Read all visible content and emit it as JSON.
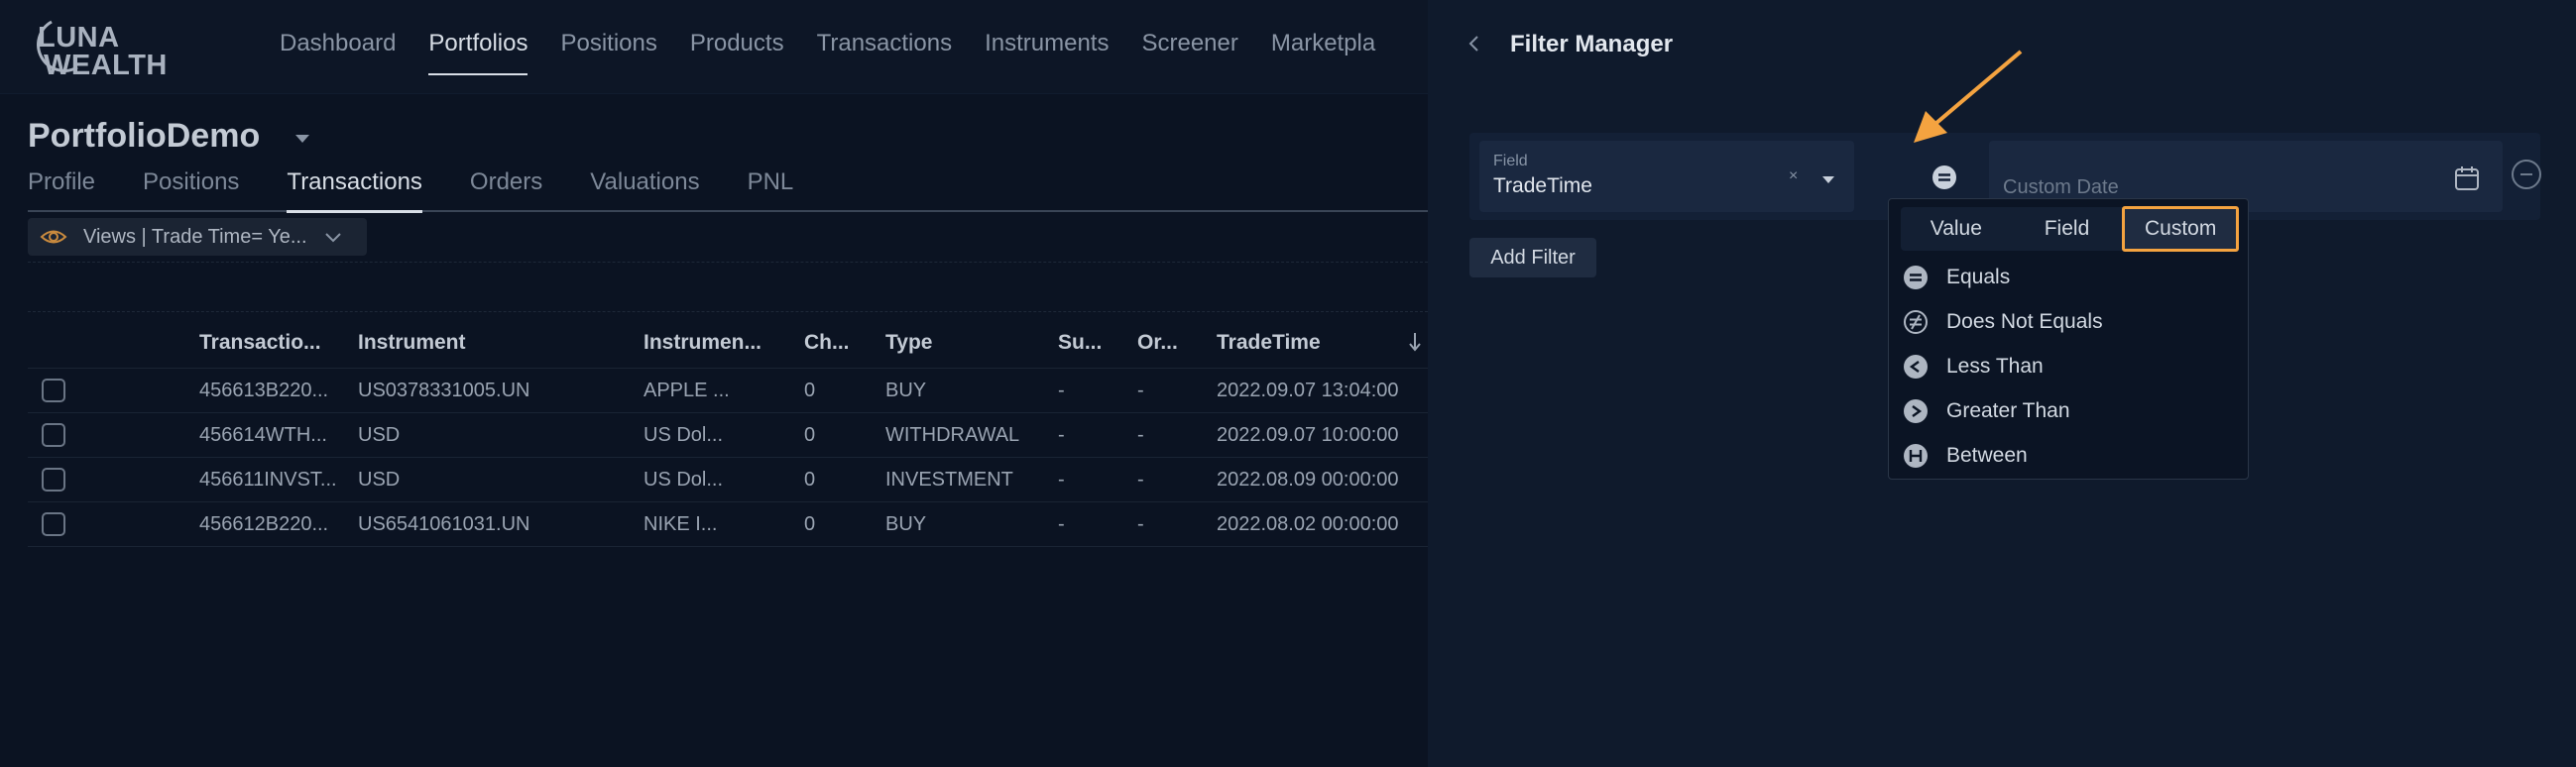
{
  "app": {
    "logo_line1": "LUNA",
    "logo_line2": "WEALTH",
    "nav": [
      "Dashboard",
      "Portfolios",
      "Positions",
      "Products",
      "Transactions",
      "Instruments",
      "Screener",
      "Marketpla"
    ],
    "portfolio_name": "PortfolioDemo",
    "subtabs": [
      "Profile",
      "Positions",
      "Transactions",
      "Orders",
      "Valuations",
      "PNL"
    ],
    "views_label": "Views | Trade Time= Ye..."
  },
  "table": {
    "headers": [
      "Transactio...",
      "Instrument",
      "Instrumen...",
      "Ch...",
      "Type",
      "Su...",
      "Or...",
      "TradeTime"
    ],
    "rows": [
      [
        "456613B220...",
        "US0378331005.UN",
        "APPLE ...",
        "0",
        "BUY",
        "-",
        "-",
        "2022.09.07 13:04:00"
      ],
      [
        "456614WTH...",
        "USD",
        "US Dol...",
        "0",
        "WITHDRAWAL",
        "-",
        "-",
        "2022.09.07 10:00:00"
      ],
      [
        "456611INVST...",
        "USD",
        "US Dol...",
        "0",
        "INVESTMENT",
        "-",
        "-",
        "2022.08.09 00:00:00"
      ],
      [
        "456612B220...",
        "US6541061031.UN",
        "NIKE I...",
        "0",
        "BUY",
        "-",
        "-",
        "2022.08.02 00:00:00"
      ]
    ]
  },
  "panel": {
    "title": "Filter Manager",
    "field_label": "Field",
    "field_value": "TradeTime",
    "field_clear": "×",
    "date_placeholder": "Custom Date",
    "add_filter": "Add Filter"
  },
  "dropdown": {
    "segments": [
      "Value",
      "Field",
      "Custom"
    ],
    "selected_segment": "Custom",
    "options": [
      "Equals",
      "Does Not Equals",
      "Less Than",
      "Greater Than",
      "Between"
    ]
  },
  "colors": {
    "highlight": "#f4a340",
    "panel_bg": "#0f1a2c",
    "app_bg": "#0b1322"
  }
}
